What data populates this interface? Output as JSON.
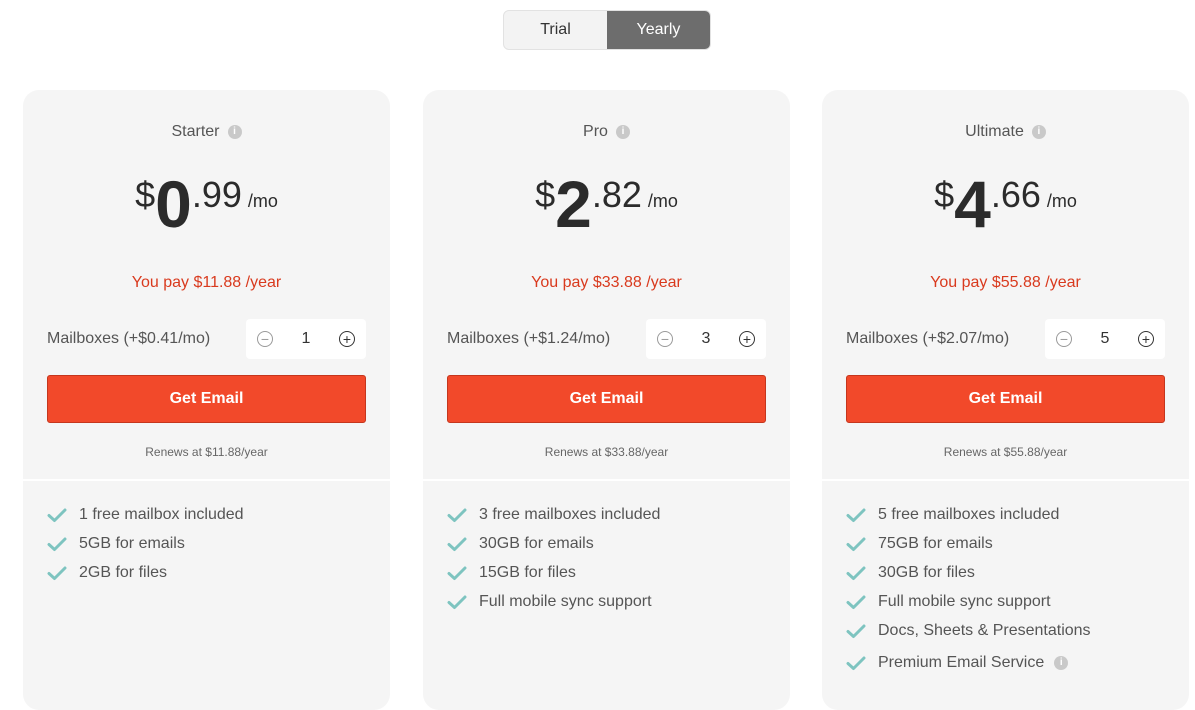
{
  "toggle": {
    "options": [
      {
        "label": "Trial",
        "active": false
      },
      {
        "label": "Yearly",
        "active": true
      }
    ]
  },
  "colors": {
    "accent": "#f2492a",
    "price_note": "#d93a1e",
    "check": "#7ec4c0",
    "card_bg": "#f5f5f5"
  },
  "plans": [
    {
      "name": "Starter",
      "currency": "$",
      "price_int": "0",
      "price_dec": ".99",
      "per": "/mo",
      "you_pay": "You pay $11.88 /year",
      "mailbox_label": "Mailboxes (+$0.41/mo)",
      "mailbox_count": "1",
      "cta": "Get Email",
      "renews": "Renews at $11.88/year",
      "features": [
        "1 free mailbox included",
        "5GB for emails",
        "2GB for files"
      ]
    },
    {
      "name": "Pro",
      "currency": "$",
      "price_int": "2",
      "price_dec": ".82",
      "per": "/mo",
      "you_pay": "You pay $33.88 /year",
      "mailbox_label": "Mailboxes (+$1.24/mo)",
      "mailbox_count": "3",
      "cta": "Get Email",
      "renews": "Renews at $33.88/year",
      "features": [
        "3 free mailboxes included",
        "30GB for emails",
        "15GB for files",
        "Full mobile sync support"
      ]
    },
    {
      "name": "Ultimate",
      "currency": "$",
      "price_int": "4",
      "price_dec": ".66",
      "per": "/mo",
      "you_pay": "You pay $55.88 /year",
      "mailbox_label": "Mailboxes (+$2.07/mo)",
      "mailbox_count": "5",
      "cta": "Get Email",
      "renews": "Renews at $55.88/year",
      "features": [
        "5 free mailboxes included",
        "75GB for emails",
        "30GB for files",
        "Full mobile sync support",
        "Docs, Sheets & Presentations",
        "Premium Email Service"
      ]
    }
  ]
}
